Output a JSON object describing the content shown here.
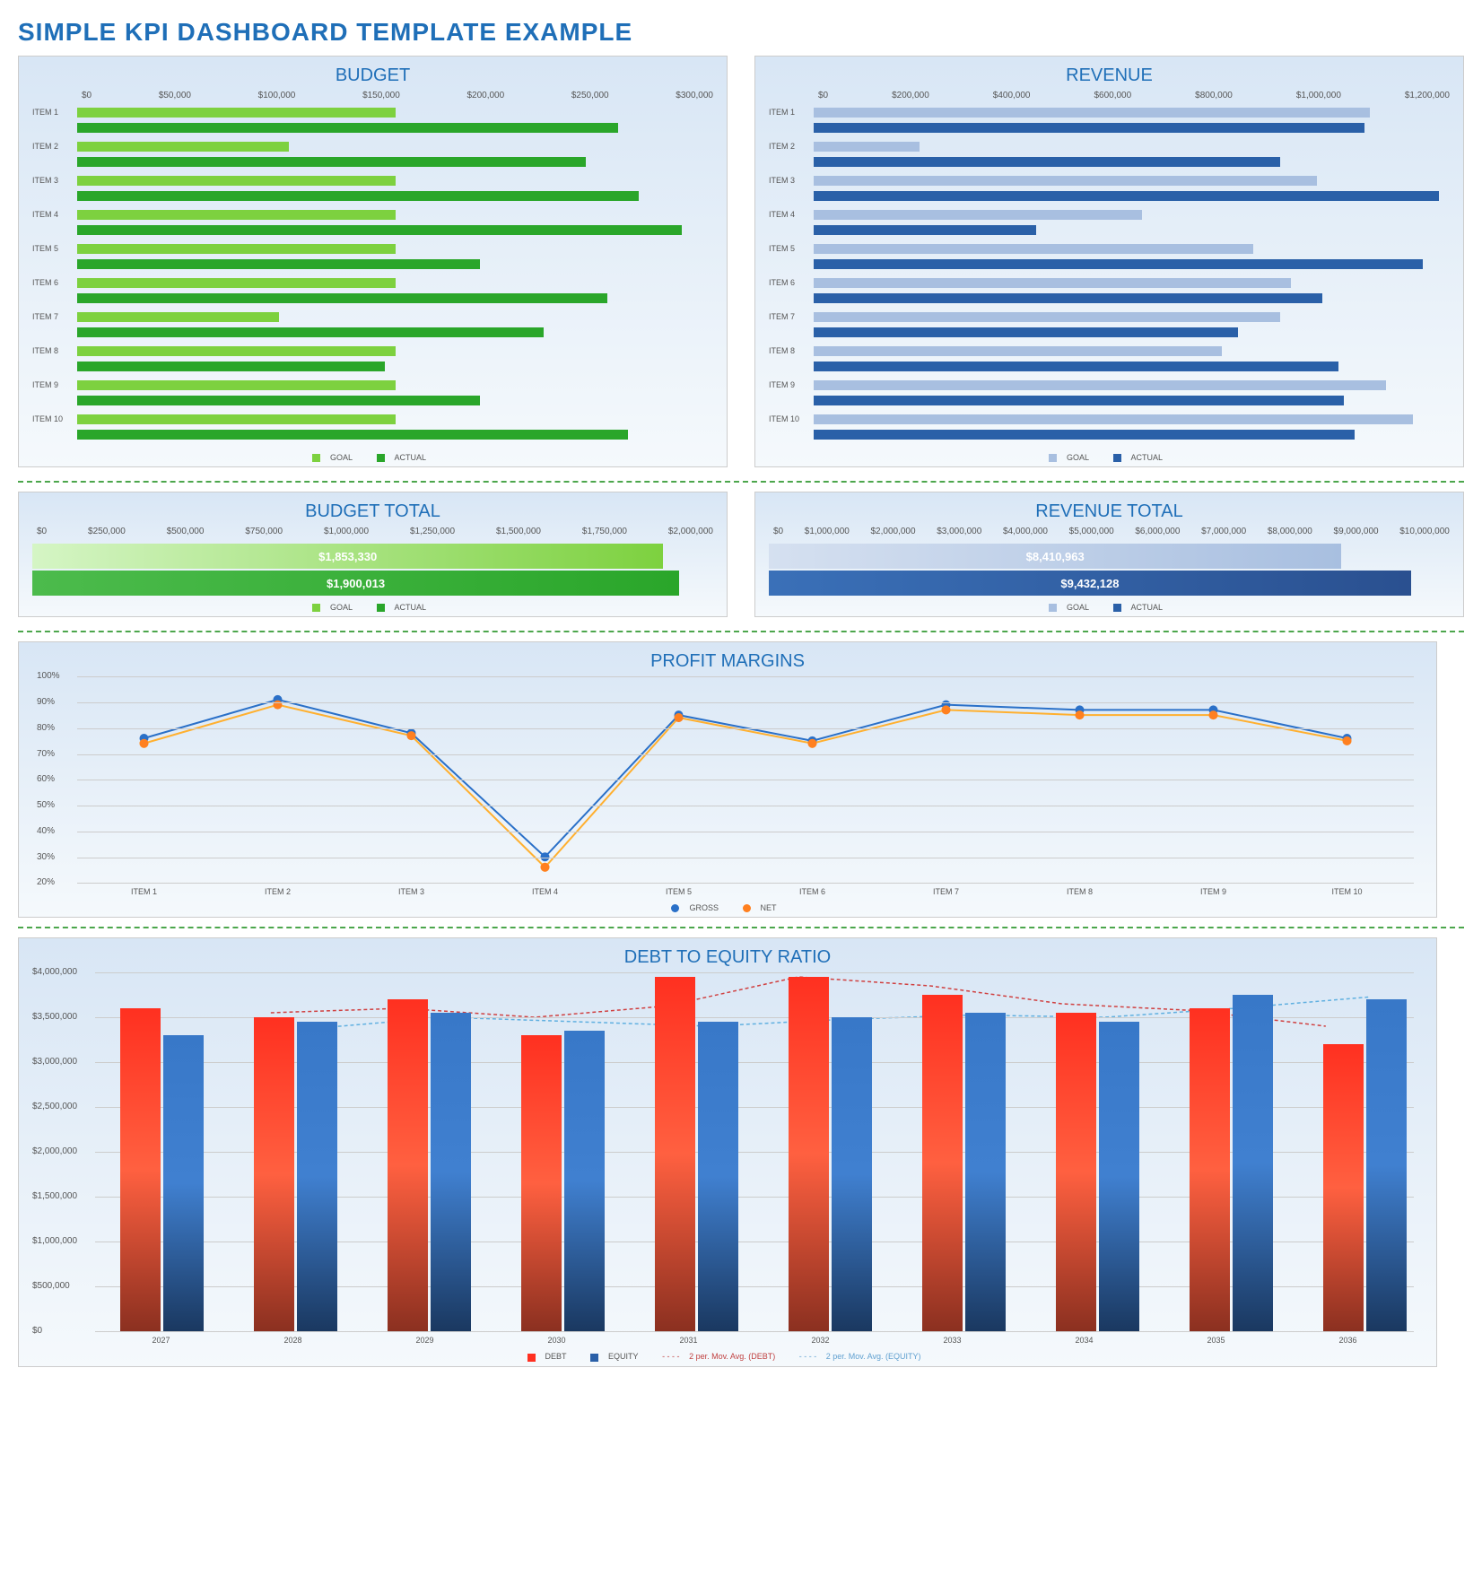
{
  "page_title": "SIMPLE KPI DASHBOARD TEMPLATE EXAMPLE",
  "budget": {
    "title": "BUDGET",
    "legend": {
      "goal": "GOAL",
      "actual": "ACTUAL"
    },
    "colors": {
      "goal": "#7dd13f",
      "actual": "#2aa62a"
    }
  },
  "revenue": {
    "title": "REVENUE",
    "legend": {
      "goal": "GOAL",
      "actual": "ACTUAL"
    },
    "colors": {
      "goal": "#a8bfe0",
      "actual": "#2a60a8"
    }
  },
  "budget_total": {
    "title": "BUDGET TOTAL",
    "goal_label": "$1,853,330",
    "actual_label": "$1,900,013",
    "legend": {
      "goal": "GOAL",
      "actual": "ACTUAL"
    }
  },
  "revenue_total": {
    "title": "REVENUE TOTAL",
    "goal_label": "$8,410,963",
    "actual_label": "$9,432,128",
    "legend": {
      "goal": "GOAL",
      "actual": "ACTUAL"
    }
  },
  "profit": {
    "title": "PROFIT MARGINS",
    "legend": {
      "gross": "GROSS",
      "net": "NET"
    }
  },
  "debt_equity": {
    "title": "DEBT TO EQUITY RATIO",
    "legend": {
      "debt": "DEBT",
      "equity": "EQUITY",
      "ma_debt": "2 per. Mov. Avg. (DEBT)",
      "ma_equity": "2 per. Mov. Avg. (EQUITY)"
    }
  },
  "chart_data": [
    {
      "id": "budget",
      "type": "bar",
      "orientation": "horizontal",
      "title": "BUDGET",
      "categories": [
        "ITEM 1",
        "ITEM 2",
        "ITEM 3",
        "ITEM 4",
        "ITEM 5",
        "ITEM 6",
        "ITEM 7",
        "ITEM 8",
        "ITEM 9",
        "ITEM 10"
      ],
      "series": [
        {
          "name": "GOAL",
          "values": [
            150000,
            100000,
            150000,
            150000,
            150000,
            150000,
            95000,
            150000,
            150000,
            150000
          ]
        },
        {
          "name": "ACTUAL",
          "values": [
            255000,
            240000,
            265000,
            285000,
            190000,
            250000,
            220000,
            145000,
            190000,
            260000
          ]
        }
      ],
      "x_ticks": [
        "$0",
        "$50,000",
        "$100,000",
        "$150,000",
        "$200,000",
        "$250,000",
        "$300,000"
      ],
      "xlim": [
        0,
        300000
      ]
    },
    {
      "id": "revenue",
      "type": "bar",
      "orientation": "horizontal",
      "title": "REVENUE",
      "categories": [
        "ITEM 1",
        "ITEM 2",
        "ITEM 3",
        "ITEM 4",
        "ITEM 5",
        "ITEM 6",
        "ITEM 7",
        "ITEM 8",
        "ITEM 9",
        "ITEM 10"
      ],
      "series": [
        {
          "name": "GOAL",
          "values": [
            1050000,
            200000,
            950000,
            620000,
            830000,
            900000,
            880000,
            770000,
            1080000,
            1130000
          ]
        },
        {
          "name": "ACTUAL",
          "values": [
            1040000,
            880000,
            1180000,
            420000,
            1150000,
            960000,
            800000,
            990000,
            1000000,
            1020000
          ]
        }
      ],
      "x_ticks": [
        "$0",
        "$200,000",
        "$400,000",
        "$600,000",
        "$800,000",
        "$1,000,000",
        "$1,200,000"
      ],
      "xlim": [
        0,
        1200000
      ]
    },
    {
      "id": "budget_total",
      "type": "bar",
      "orientation": "horizontal",
      "title": "BUDGET TOTAL",
      "categories": [
        ""
      ],
      "series": [
        {
          "name": "GOAL",
          "values": [
            1853330
          ]
        },
        {
          "name": "ACTUAL",
          "values": [
            1900013
          ]
        }
      ],
      "x_ticks": [
        "$0",
        "$250,000",
        "$500,000",
        "$750,000",
        "$1,000,000",
        "$1,250,000",
        "$1,500,000",
        "$1,750,000",
        "$2,000,000"
      ],
      "xlim": [
        0,
        2000000
      ]
    },
    {
      "id": "revenue_total",
      "type": "bar",
      "orientation": "horizontal",
      "title": "REVENUE TOTAL",
      "categories": [
        ""
      ],
      "series": [
        {
          "name": "GOAL",
          "values": [
            8410963
          ]
        },
        {
          "name": "ACTUAL",
          "values": [
            9432128
          ]
        }
      ],
      "x_ticks": [
        "$0",
        "$1,000,000",
        "$2,000,000",
        "$3,000,000",
        "$4,000,000",
        "$5,000,000",
        "$6,000,000",
        "$7,000,000",
        "$8,000,000",
        "$9,000,000",
        "$10,000,000"
      ],
      "xlim": [
        0,
        10000000
      ]
    },
    {
      "id": "profit_margins",
      "type": "line",
      "title": "PROFIT MARGINS",
      "categories": [
        "ITEM 1",
        "ITEM 2",
        "ITEM 3",
        "ITEM 4",
        "ITEM 5",
        "ITEM 6",
        "ITEM 7",
        "ITEM 8",
        "ITEM 9",
        "ITEM 10"
      ],
      "series": [
        {
          "name": "GROSS",
          "values": [
            76,
            91,
            78,
            30,
            85,
            75,
            89,
            87,
            87,
            76
          ]
        },
        {
          "name": "NET",
          "values": [
            74,
            89,
            77,
            26,
            84,
            74,
            87,
            85,
            85,
            75
          ]
        }
      ],
      "y_ticks": [
        "20%",
        "30%",
        "40%",
        "50%",
        "60%",
        "70%",
        "80%",
        "90%",
        "100%"
      ],
      "ylim": [
        20,
        100
      ]
    },
    {
      "id": "debt_equity",
      "type": "bar",
      "title": "DEBT TO EQUITY RATIO",
      "categories": [
        "2027",
        "2028",
        "2029",
        "2030",
        "2031",
        "2032",
        "2033",
        "2034",
        "2035",
        "2036"
      ],
      "series": [
        {
          "name": "DEBT",
          "values": [
            3600000,
            3500000,
            3700000,
            3300000,
            3950000,
            3950000,
            3750000,
            3550000,
            3600000,
            3200000
          ]
        },
        {
          "name": "EQUITY",
          "values": [
            3300000,
            3450000,
            3550000,
            3350000,
            3450000,
            3500000,
            3550000,
            3450000,
            3750000,
            3700000
          ]
        }
      ],
      "y_ticks": [
        "$0",
        "$500,000",
        "$1,000,000",
        "$1,500,000",
        "$2,000,000",
        "$2,500,000",
        "$3,000,000",
        "$3,500,000",
        "$4,000,000"
      ],
      "ylim": [
        0,
        4000000
      ]
    }
  ]
}
